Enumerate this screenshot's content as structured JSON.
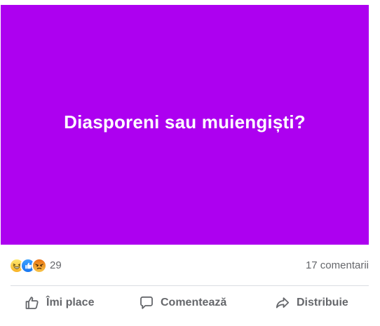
{
  "post": {
    "background_color": "#ad00f0",
    "text": "Diasporeni sau muiengiști?"
  },
  "reactions": {
    "items": [
      "haha",
      "like",
      "angry"
    ],
    "count": "29",
    "comments": "17 comentarii"
  },
  "actions": {
    "like": "Îmi place",
    "comment": "Comentează",
    "share": "Distribuie"
  },
  "colors": {
    "text_muted": "#65676b",
    "haha": "#f7b125",
    "like": "#1877f2",
    "angry": "#e9710f"
  }
}
